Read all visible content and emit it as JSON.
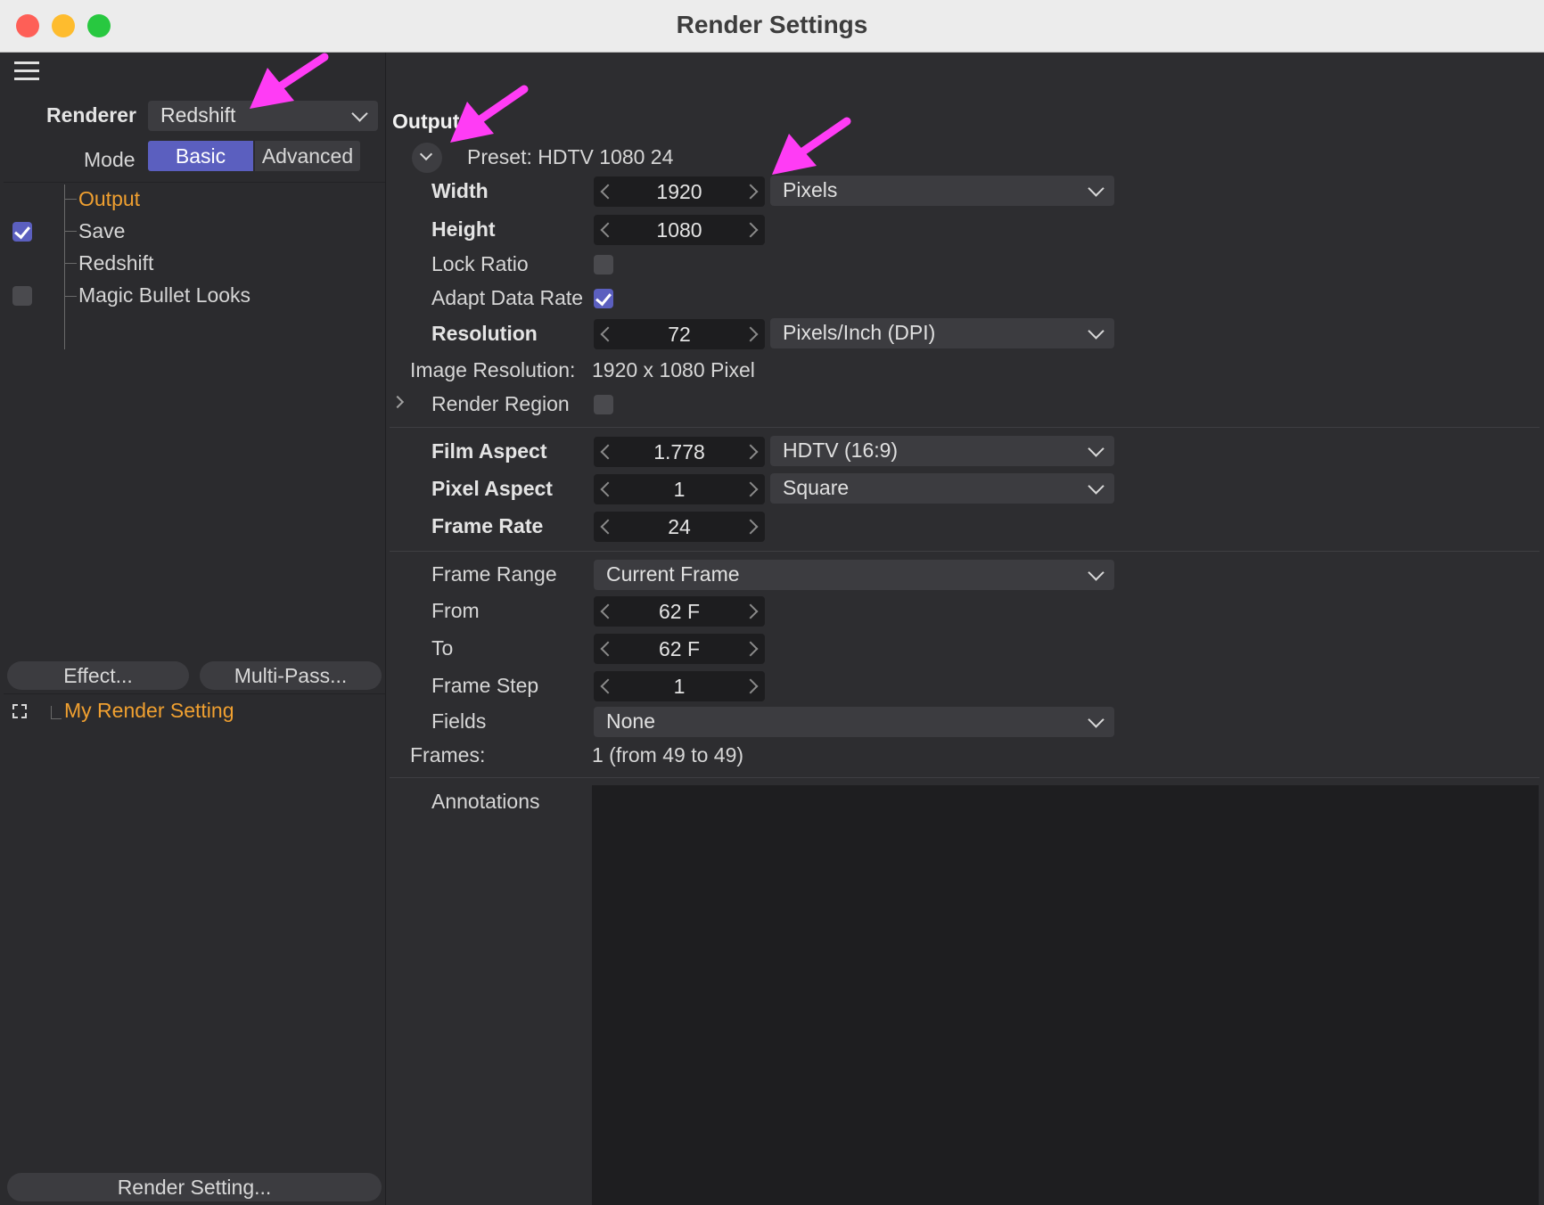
{
  "window": {
    "title": "Render Settings"
  },
  "colors": {
    "accent": "#5b5fbf",
    "active_item": "#f0a030",
    "annotation_arrow": "#ff3cf5"
  },
  "icons": [
    "menu-icon",
    "chevron-down-icon",
    "checkmark-icon",
    "expand-icon"
  ],
  "sidebar": {
    "renderer_label": "Renderer",
    "renderer_value": "Redshift",
    "mode_label": "Mode",
    "mode_basic": "Basic",
    "mode_advanced": "Advanced",
    "items": [
      {
        "label": "Output",
        "checked": null,
        "active": true
      },
      {
        "label": "Save",
        "checked": true
      },
      {
        "label": "Redshift",
        "checked": null
      },
      {
        "label": "Magic Bullet Looks",
        "checked": false
      }
    ],
    "effect_button": "Effect...",
    "multipass_button": "Multi-Pass...",
    "render_setting_name": "My Render Setting",
    "render_setting_button": "Render Setting..."
  },
  "output": {
    "section_title": "Output",
    "preset": "Preset: HDTV 1080 24",
    "width_label": "Width",
    "width_value": "1920",
    "width_unit": "Pixels",
    "height_label": "Height",
    "height_value": "1080",
    "lock_ratio_label": "Lock Ratio",
    "lock_ratio_checked": false,
    "adapt_data_rate_label": "Adapt Data Rate",
    "adapt_data_rate_checked": true,
    "resolution_label": "Resolution",
    "resolution_value": "72",
    "resolution_unit": "Pixels/Inch (DPI)",
    "image_resolution_label": "Image Resolution:",
    "image_resolution_value": "1920 x 1080 Pixel",
    "render_region_label": "Render Region",
    "render_region_checked": false,
    "film_aspect_label": "Film Aspect",
    "film_aspect_value": "1.778",
    "film_aspect_preset": "HDTV (16:9)",
    "pixel_aspect_label": "Pixel Aspect",
    "pixel_aspect_value": "1",
    "pixel_aspect_preset": "Square",
    "frame_rate_label": "Frame Rate",
    "frame_rate_value": "24",
    "frame_range_label": "Frame Range",
    "frame_range_value": "Current Frame",
    "from_label": "From",
    "from_value": "62 F",
    "to_label": "To",
    "to_value": "62 F",
    "frame_step_label": "Frame Step",
    "frame_step_value": "1",
    "fields_label": "Fields",
    "fields_value": "None",
    "frames_label": "Frames:",
    "frames_value": "1 (from 49 to 49)",
    "annotations_label": "Annotations"
  }
}
